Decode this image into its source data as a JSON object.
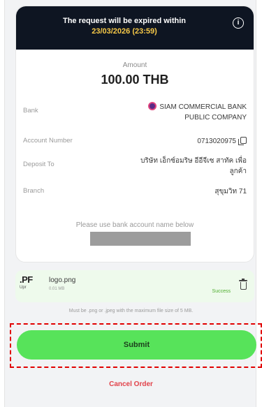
{
  "expiry": {
    "message": "The request will be expired within",
    "deadline": "23/03/2026 (23:59)",
    "info_icon": "info-icon"
  },
  "amount": {
    "label": "Amount",
    "value": "100.00 THB"
  },
  "details": {
    "bank_label": "Bank",
    "bank_value": "SIAM COMMERCIAL BANK PUBLIC COMPANY",
    "account_number_label": "Account Number",
    "account_number_value": "0713020975",
    "deposit_to_label": "Deposit To",
    "deposit_to_value": "บริษัท เอ็กซ์อมริษ อีอีจีเซ สาทัค เพื่อลูกค้า",
    "branch_label": "Branch",
    "branch_value": "สุขุมวิท 71"
  },
  "notice": "Please use bank account name below",
  "upload": {
    "thumb_big": ".PF",
    "thumb_small": "Upr",
    "file_name": "logo.png",
    "file_size": "0.01 MB",
    "status": "Success",
    "hint": "Must be .png or .jpeg with the maximum file size of 5 MB."
  },
  "actions": {
    "submit_label": "Submit",
    "cancel_label": "Cancel Order"
  },
  "colors": {
    "banner_bg": "#0e1522",
    "deadline": "#f7c948",
    "submit_bg": "#57e35a",
    "cancel_text": "#e2424a",
    "highlight_border": "#e10000"
  }
}
